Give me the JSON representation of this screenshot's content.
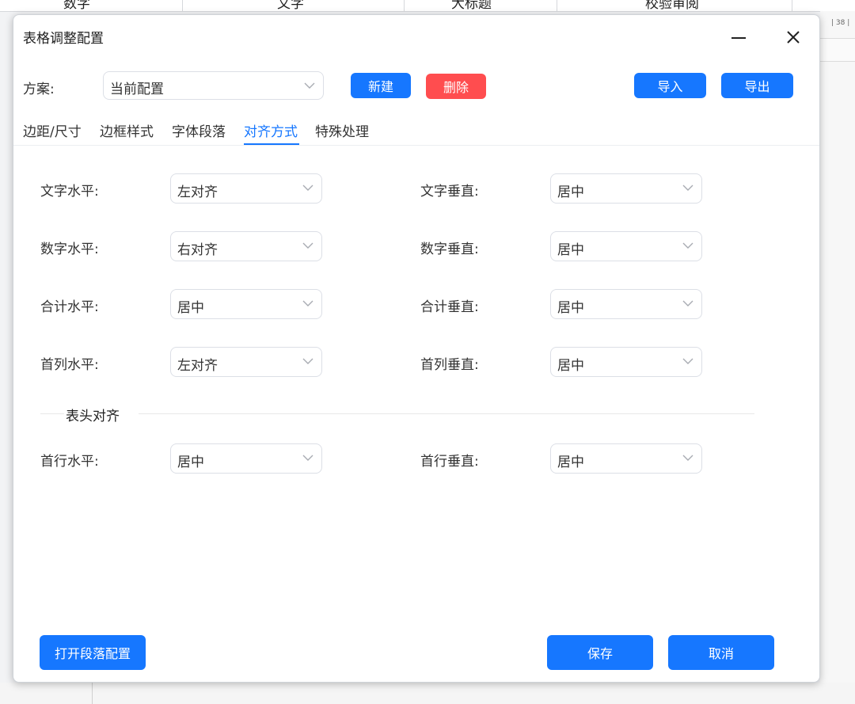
{
  "background": {
    "columns": [
      "数字",
      "文字",
      "大标题",
      "校验审阅"
    ],
    "page_number": "| 38 |"
  },
  "dialog": {
    "title": "表格调整配置",
    "scheme": {
      "label": "方案:",
      "value": "当前配置"
    },
    "buttons": {
      "new": "新建",
      "delete": "删除",
      "import": "导入",
      "export": "导出",
      "paragraph_config": "打开段落配置",
      "save": "保存",
      "cancel": "取消"
    },
    "tabs": [
      {
        "label": "边距/尺寸",
        "active": false
      },
      {
        "label": "边框样式",
        "active": false
      },
      {
        "label": "字体段落",
        "active": false
      },
      {
        "label": "对齐方式",
        "active": true
      },
      {
        "label": "特殊处理",
        "active": false
      }
    ],
    "alignment_rows": [
      {
        "h_label": "文字水平:",
        "h_value": "左对齐",
        "v_label": "文字垂直:",
        "v_value": "居中"
      },
      {
        "h_label": "数字水平:",
        "h_value": "右对齐",
        "v_label": "数字垂直:",
        "v_value": "居中"
      },
      {
        "h_label": "合计水平:",
        "h_value": "居中",
        "v_label": "合计垂直:",
        "v_value": "居中"
      },
      {
        "h_label": "首列水平:",
        "h_value": "左对齐",
        "v_label": "首列垂直:",
        "v_value": "居中"
      }
    ],
    "header_section": {
      "title": "表头对齐",
      "row": {
        "h_label": "首行水平:",
        "h_value": "居中",
        "v_label": "首行垂直:",
        "v_value": "居中"
      }
    }
  },
  "colors": {
    "primary": "#1677ff",
    "danger": "#ff4d4f",
    "active_tab": "#1677ff"
  },
  "icons": {
    "minimize": "minimize-icon",
    "close": "close-icon",
    "dropdown": "chevron-down-icon"
  }
}
